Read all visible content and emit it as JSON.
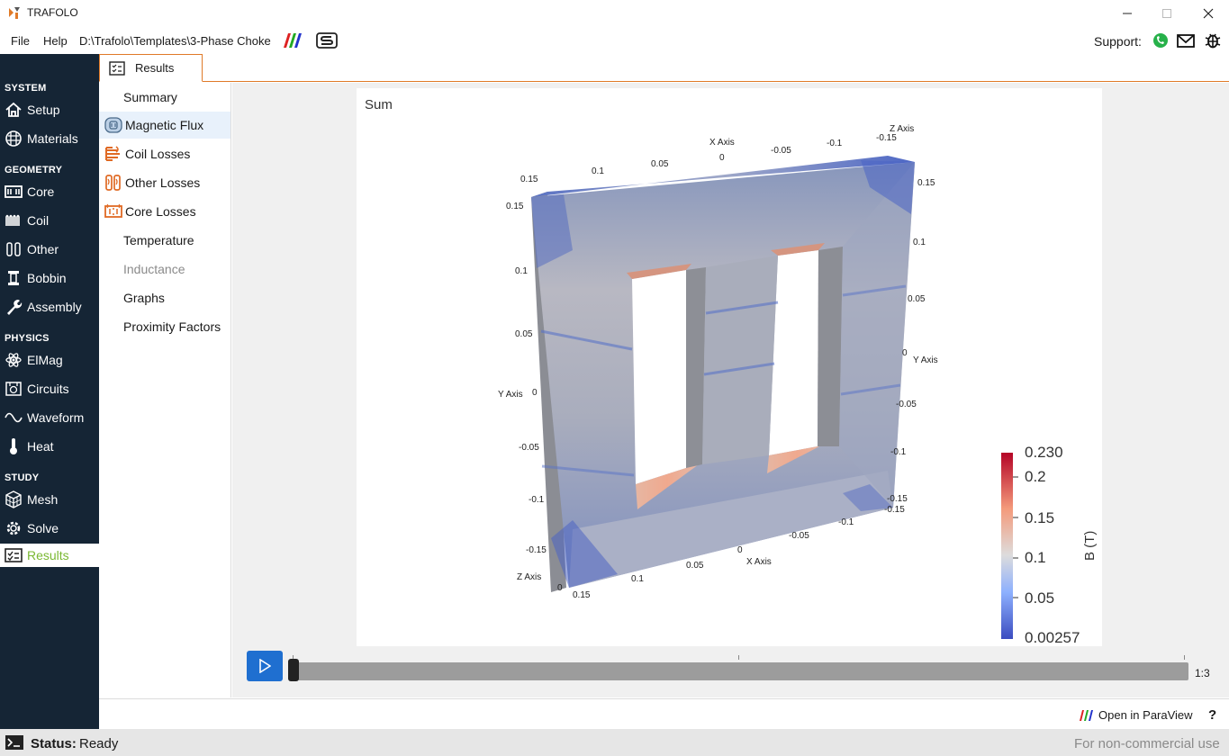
{
  "app": {
    "title": "TRAFOLO",
    "colors": {
      "nav_bg": "#152535",
      "accent": "#e07a28",
      "active_green": "#7ab832",
      "play_blue": "#1f6fd0"
    }
  },
  "menubar": {
    "file": "File",
    "help": "Help",
    "path": "D:\\Trafolo\\Templates\\3-Phase Choke",
    "support": "Support:"
  },
  "nav": {
    "sections": {
      "system": "SYSTEM",
      "geometry": "GEOMETRY",
      "physics": "PHYSICS",
      "study": "STUDY"
    },
    "items": {
      "setup": "Setup",
      "materials": "Materials",
      "core": "Core",
      "coil": "Coil",
      "other": "Other",
      "bobbin": "Bobbin",
      "assembly": "Assembly",
      "elmag": "ElMag",
      "circuits": "Circuits",
      "waveform": "Waveform",
      "heat": "Heat",
      "mesh": "Mesh",
      "solve": "Solve",
      "results": "Results"
    },
    "active": "results"
  },
  "tab": {
    "label": "Results"
  },
  "submenu": {
    "summary": "Summary",
    "magnetic_flux": "Magnetic Flux",
    "coil_losses": "Coil Losses",
    "other_losses": "Other Losses",
    "core_losses": "Core Losses",
    "temperature": "Temperature",
    "inductance": "Inductance",
    "graphs": "Graphs",
    "proximity": "Proximity Factors",
    "active": "magnetic_flux"
  },
  "viewport": {
    "title": "Sum",
    "axes": {
      "x_axis": "X Axis",
      "y_axis": "Y Axis",
      "z_axis": "Z Axis",
      "top_x": [
        "0.15",
        "0.1",
        "0.05",
        "0",
        "-0.05",
        "-0.1",
        "-0.15"
      ],
      "left_y": [
        "0.15",
        "0.1",
        "0.05",
        "0",
        "-0.05",
        "-0.1",
        "-0.15"
      ],
      "right_y": [
        "0.15",
        "0.1",
        "0.05",
        "0",
        "-0.05",
        "-0.1",
        "-0.15"
      ],
      "bottom_x": [
        "0.15",
        "0.1",
        "0.05",
        "0",
        "-0.05",
        "-0.1",
        "-0.15"
      ],
      "z_top_a": "-0.15",
      "z_bottom_0": "0"
    },
    "colorbar": {
      "label": "B (T)",
      "max": "0.230",
      "ticks": [
        "0.2",
        "0.15",
        "0.1",
        "0.05"
      ],
      "min": "0.00257"
    }
  },
  "player": {
    "frame": "1:3"
  },
  "actions": {
    "paraview": "Open in ParaView",
    "help": "?"
  },
  "status": {
    "label": "Status:",
    "value": "Ready",
    "license": "For non-commercial use"
  }
}
